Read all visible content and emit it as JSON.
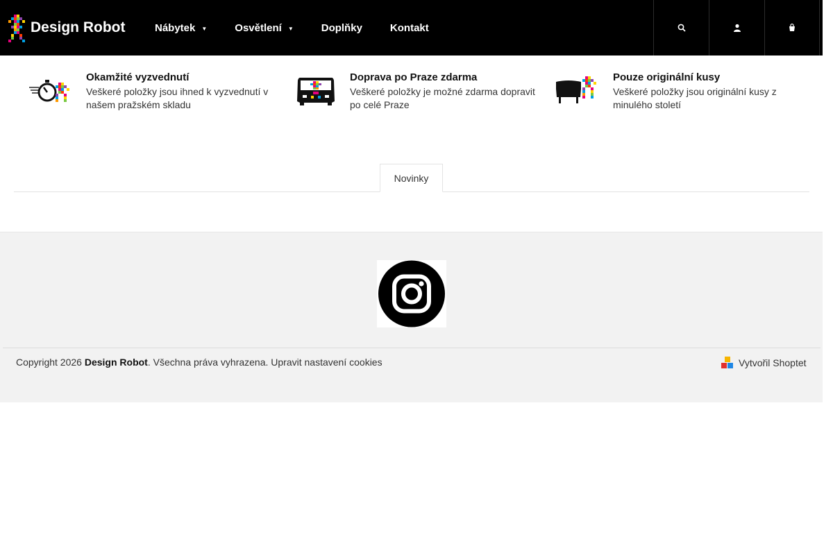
{
  "header": {
    "logo_text": "Design Robot",
    "nav": [
      {
        "label": "Nábytek",
        "has_dropdown": true
      },
      {
        "label": "Osvětlení",
        "has_dropdown": true
      },
      {
        "label": "Doplňky",
        "has_dropdown": false
      },
      {
        "label": "Kontakt",
        "has_dropdown": false
      }
    ],
    "buttons": [
      "search-icon",
      "user-icon",
      "cart-icon"
    ]
  },
  "benefits": [
    {
      "icon": "stopwatch-icon",
      "title": "Okamžité vyzvednutí",
      "desc": "Veškeré položky jsou ihned k vyzvednutí v našem pražském skladu"
    },
    {
      "icon": "van-icon",
      "title": "Doprava po Praze zdarma",
      "desc": "Veškeré položky je možné zdarma dopravit po celé Praze"
    },
    {
      "icon": "armchair-icon",
      "title": "Pouze originální kusy",
      "desc": "Veškeré položky jsou originální kusy z minulého století"
    }
  ],
  "tabs": {
    "active": "Novinky"
  },
  "footer": {
    "social_icon": "instagram-icon",
    "copyright_prefix": "Copyright 2026 ",
    "copyright_brand": "Design Robot",
    "copyright_rest": ". Všechna práva vyhrazena. ",
    "cookies_link": "Upravit nastavení cookies",
    "shoptet_label": "Vytvořil Shoptet"
  },
  "colors": {
    "header_bg": "#000000",
    "footer_bg": "#f2f2f2"
  }
}
